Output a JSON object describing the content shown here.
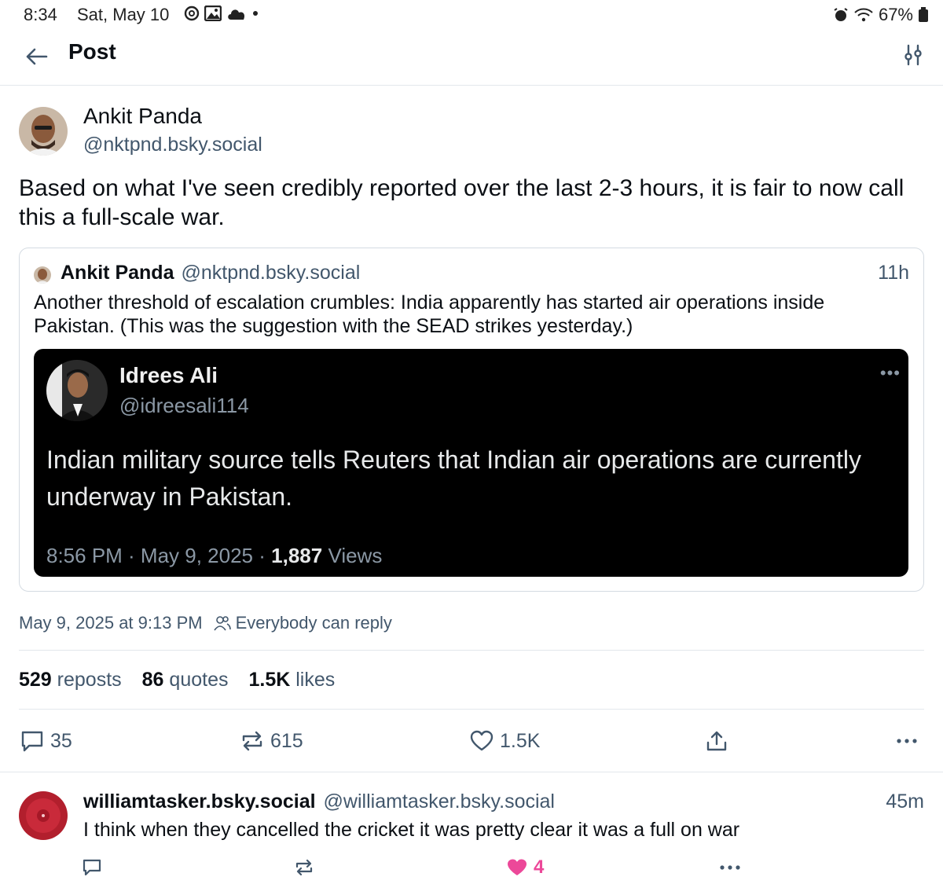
{
  "status": {
    "time": "8:34",
    "date": "Sat, May 10",
    "battery": "67%"
  },
  "header": {
    "title": "Post"
  },
  "post": {
    "author_name": "Ankit Panda",
    "author_handle": "@nktpnd.bsky.social",
    "text": "Based on what I've seen credibly reported over the last 2-3 hours, it is fair to now call this a full-scale war.",
    "quote": {
      "author_name": "Ankit Panda",
      "author_handle": "@nktpnd.bsky.social",
      "time": "11h",
      "text": "Another threshold of escalation crumbles: India apparently has started air operations inside Pakistan. (This was the suggestion with the SEAD strikes yesterday.)",
      "embed": {
        "name": "Idrees Ali",
        "handle": "@idreesali114",
        "text": "Indian military source tells Reuters that Indian air operations are currently underway in Pakistan.",
        "meta_time": "8:56 PM · May 9, 2025 · ",
        "views_count": "1,887",
        "views_label": " Views"
      }
    },
    "timestamp": "May 9, 2025 at 9:13 PM",
    "reply_setting": "Everybody can reply",
    "counts": {
      "reposts_num": "529",
      "reposts_label": "reposts",
      "quotes_num": "86",
      "quotes_label": "quotes",
      "likes_num": "1.5K",
      "likes_label": "likes"
    },
    "actions": {
      "replies": "35",
      "reposts": "615",
      "likes": "1.5K"
    }
  },
  "reply": {
    "author_name": "williamtasker.bsky.social",
    "author_handle": "@williamtasker.bsky.social",
    "time": "45m",
    "text": "I think when they cancelled the cricket it was pretty clear it was a full on war",
    "likes": "4",
    "like_color": "#ec4899"
  },
  "colors": {
    "muted": "#42576c",
    "border": "#e3e7ec"
  }
}
